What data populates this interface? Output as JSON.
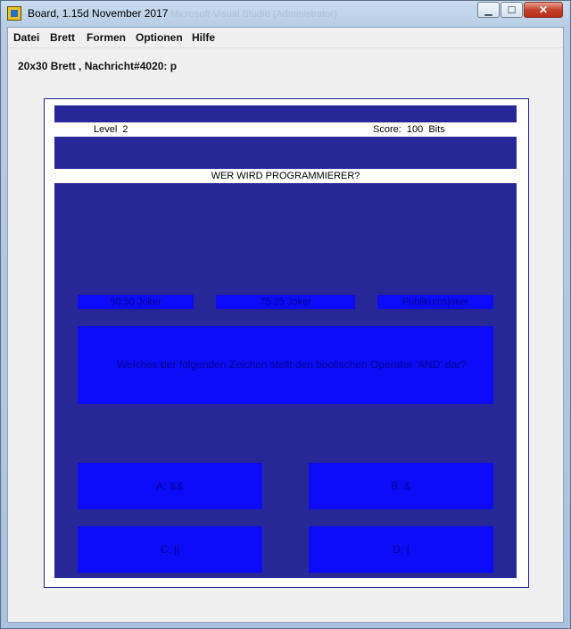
{
  "window": {
    "title": "Board, 1.15d November 2017",
    "background_title": "Microsoft Visual Studio (Administrator)",
    "controls": {
      "minimize": "▁",
      "maximize": "☐",
      "close": "✕"
    }
  },
  "menu": [
    "Datei",
    "Brett",
    "Formen",
    "Optionen",
    "Hilfe"
  ],
  "status_line": "20x30 Brett , Nachricht#4020: p",
  "game": {
    "level_label": "Level  2",
    "score_label": "Score:  100  Bits",
    "title": "WER WIRD PROGRAMMIERER?",
    "jokers": [
      "50:50 Joker",
      "75:25 Joker",
      "Publikumsjoker"
    ],
    "question": "Welches der folgenden Zeichen stellt den boolischen Operator 'AND' dar?",
    "answers": [
      "A: &&",
      "B: &",
      "C: ||",
      "D: |"
    ]
  },
  "colors": {
    "board": "#272798",
    "button": "#0b0bf7",
    "button_text": "#040490",
    "frame": "#22228a"
  }
}
